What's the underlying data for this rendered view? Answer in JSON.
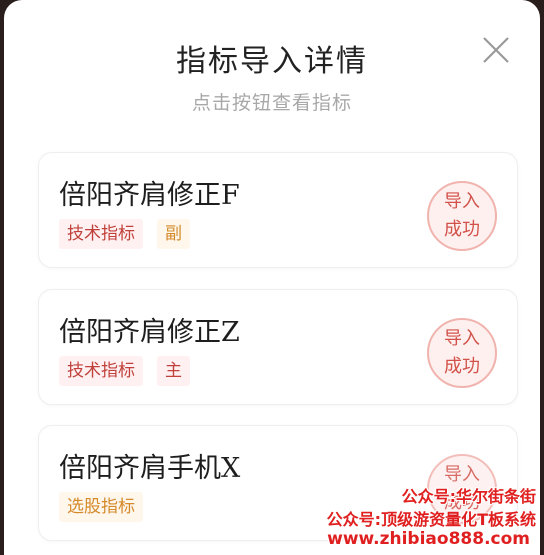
{
  "dialog": {
    "title": "指标导入详情",
    "subtitle": "点击按钮查看指标"
  },
  "cards": [
    {
      "name": "倍阳齐肩修正F",
      "tags": [
        "技术指标",
        "副"
      ],
      "status_line1": "导入",
      "status_line2": "成功"
    },
    {
      "name": "倍阳齐肩修正Z",
      "tags": [
        "技术指标",
        "主"
      ],
      "status_line1": "导入",
      "status_line2": "成功"
    },
    {
      "name": "倍阳齐肩手机X",
      "tags": [
        "选股指标"
      ],
      "status_line1": "导入",
      "status_line2": "成功"
    }
  ],
  "watermark": {
    "line1": "公众号:华尔街条街",
    "line2": "公众号:顶级游资量化T板系统",
    "line3": "www.zhibiao888.com"
  },
  "colors": {
    "accent_red": "#c0413b",
    "accent_orange": "#d58a2a",
    "stamp_border": "#f1b3ad"
  },
  "icons": {
    "close": "close-icon"
  }
}
